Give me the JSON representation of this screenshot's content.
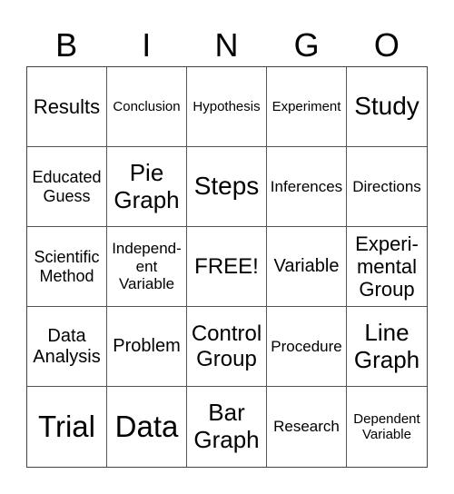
{
  "header": {
    "letters": [
      "B",
      "I",
      "N",
      "G",
      "O"
    ]
  },
  "cells": [
    [
      "Results",
      "Conclusion",
      "Hypothesis",
      "Experiment",
      "Study"
    ],
    [
      "Educated Guess",
      "Pie Graph",
      "Steps",
      "Inferences",
      "Directions"
    ],
    [
      "Scientific Method",
      "Independ-ent Variable",
      "FREE!",
      "Variable",
      "Experi-mental Group"
    ],
    [
      "Data Analysis",
      "Problem",
      "Control Group",
      "Procedure",
      "Line Graph"
    ],
    [
      "Trial",
      "Data",
      "Bar Graph",
      "Research",
      "Dependent Variable"
    ]
  ]
}
